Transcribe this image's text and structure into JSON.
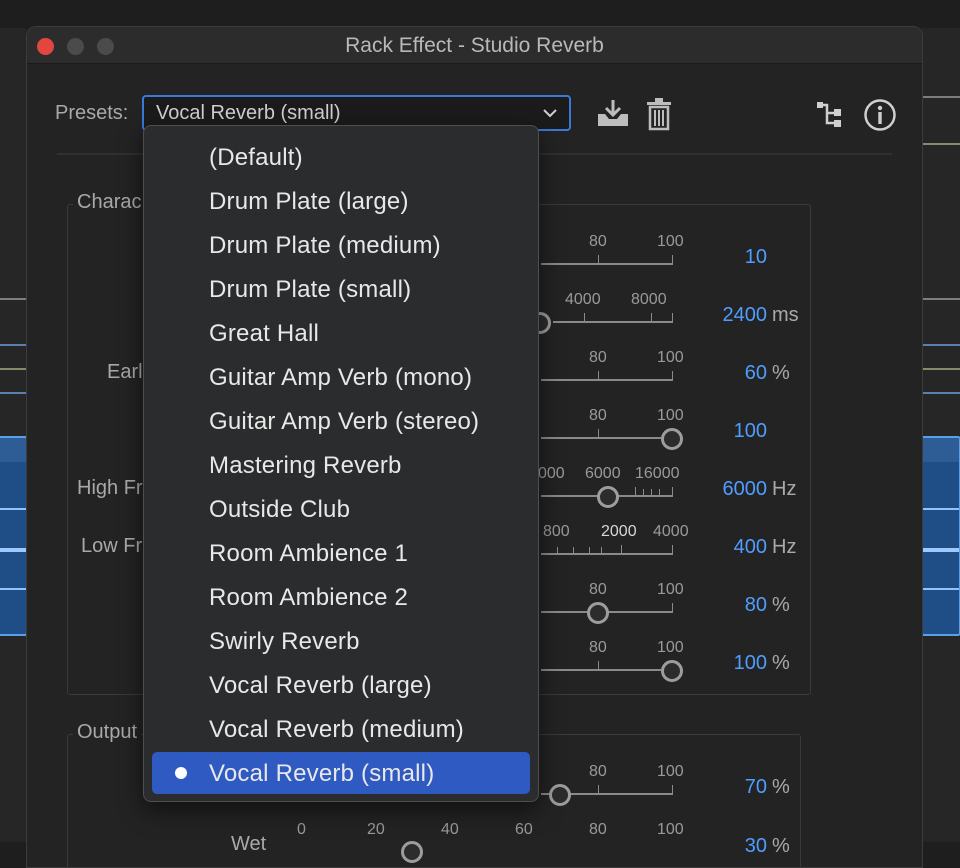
{
  "window": {
    "title": "Rack Effect - Studio Reverb"
  },
  "toolbar": {
    "presets_label": "Presets:",
    "selected_preset": "Vocal Reverb (small)",
    "icons": [
      "save-preset-icon",
      "delete-preset-icon",
      "routing-icon",
      "info-icon"
    ]
  },
  "characteristics": {
    "group_title_partial": "Charac",
    "label_early_partial": "Earl",
    "label_high_partial": "High Fr",
    "label_low_partial": "Low Fr"
  },
  "output": {
    "group_title_partial": "Output",
    "label_wet_partial": "Wet"
  },
  "rows": [
    {
      "ticks": [
        "80",
        "100"
      ],
      "value": "10",
      "unit": ""
    },
    {
      "ticks": [
        "4000",
        "8000"
      ],
      "value": "2400",
      "unit": "ms"
    },
    {
      "ticks": [
        "80",
        "100"
      ],
      "value": "60",
      "unit": "%"
    },
    {
      "ticks": [
        "80",
        "100"
      ],
      "value": "100",
      "unit": ""
    },
    {
      "ticks": [
        "000",
        "6000",
        "16000"
      ],
      "value": "6000",
      "unit": "Hz"
    },
    {
      "ticks": [
        "800",
        "2000",
        "4000"
      ],
      "value": "400",
      "unit": "Hz"
    },
    {
      "ticks": [
        "80",
        "100"
      ],
      "value": "80",
      "unit": "%"
    },
    {
      "ticks": [
        "80",
        "100"
      ],
      "value": "100",
      "unit": "%"
    },
    {
      "ticks": [
        "80",
        "100"
      ],
      "value": "70",
      "unit": "%"
    },
    {
      "ticks": [
        "0",
        "20",
        "40",
        "60",
        "80",
        "100"
      ],
      "value": "30",
      "unit": "%"
    }
  ],
  "preset_menu": {
    "items": [
      "(Default)",
      "Drum Plate (large)",
      "Drum Plate (medium)",
      "Drum Plate (small)",
      "Great Hall",
      "Guitar Amp Verb (mono)",
      "Guitar Amp Verb (stereo)",
      "Mastering Reverb",
      "Outside Club",
      "Room Ambience 1",
      "Room Ambience 2",
      "Swirly Reverb",
      "Vocal Reverb (large)",
      "Vocal Reverb (medium)",
      "Vocal Reverb (small)"
    ],
    "selected_index": 14
  },
  "colors": {
    "accent": "#2f5ac1",
    "value_blue": "#4f9eff",
    "focus_ring": "#3b78d8",
    "close_red": "#e2463f"
  }
}
